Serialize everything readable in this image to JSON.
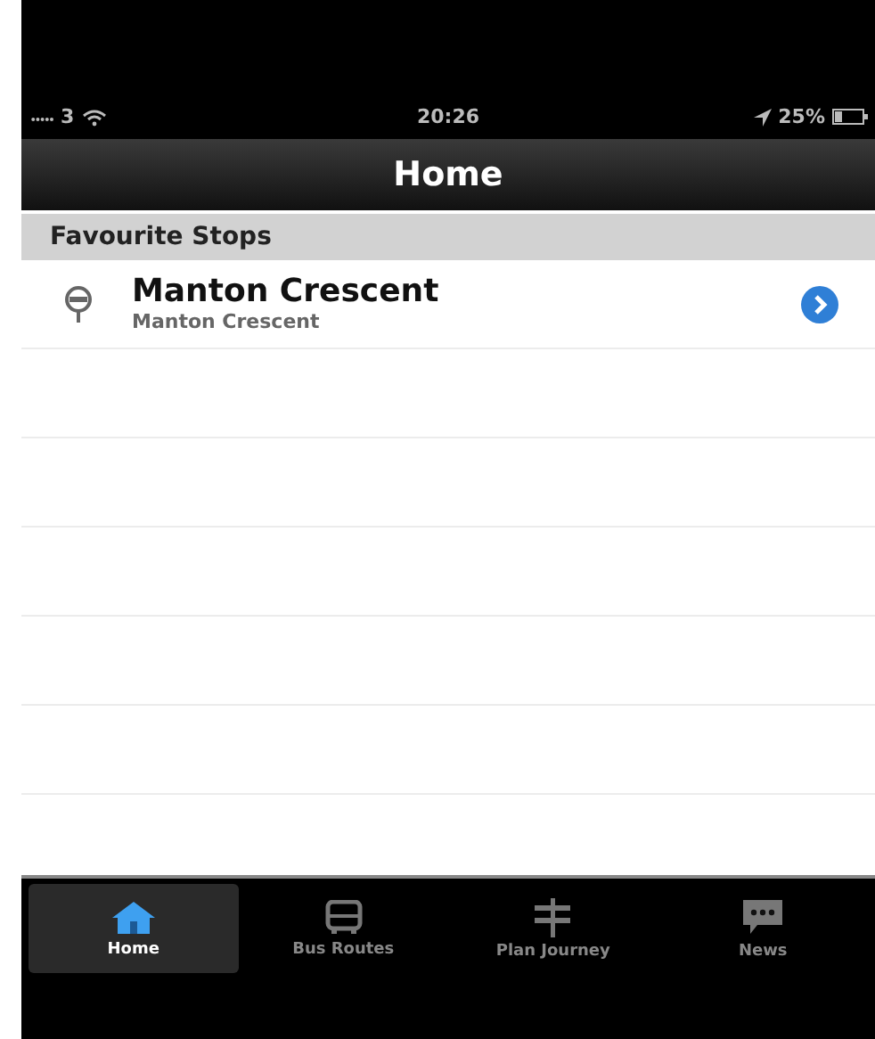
{
  "status_bar": {
    "carrier": "3",
    "time": "20:26",
    "battery": "25%"
  },
  "nav_bar": {
    "title": "Home"
  },
  "section": {
    "title": "Favourite Stops"
  },
  "stops": [
    {
      "name": "Manton Crescent",
      "subtitle": "Manton Crescent"
    }
  ],
  "tabs": [
    {
      "label": "Home",
      "kind": "home",
      "selected": true
    },
    {
      "label": "Bus Routes",
      "kind": "bus",
      "selected": false
    },
    {
      "label": "Plan Journey",
      "kind": "signpost",
      "selected": false
    },
    {
      "label": "News",
      "kind": "chat",
      "selected": false
    }
  ]
}
